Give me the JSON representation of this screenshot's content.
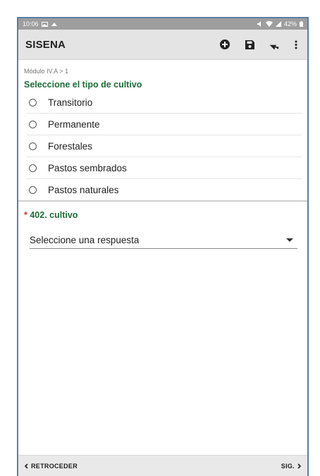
{
  "status_bar": {
    "time": "10:06",
    "battery": "42%"
  },
  "app_bar": {
    "title": "SISENA",
    "icons": [
      "add-circle-icon",
      "save-icon",
      "pointer-icon",
      "more-vert-icon"
    ]
  },
  "breadcrumb": "Módulo IV.A > 1",
  "question1": {
    "label": "Seleccione el tipo de cultivo",
    "options": [
      "Transitorio",
      "Permanente",
      "Forestales",
      "Pastos sembrados",
      "Pastos naturales"
    ]
  },
  "question2": {
    "required_mark": "*",
    "label": "402. cultivo",
    "select_value": "Seleccione una respuesta"
  },
  "footer": {
    "back_label": "RETROCEDER",
    "next_label": "SIG."
  },
  "colors": {
    "accent": "#1e6b38",
    "required": "#d32f2f",
    "app_bar": "#e4e4e4"
  }
}
